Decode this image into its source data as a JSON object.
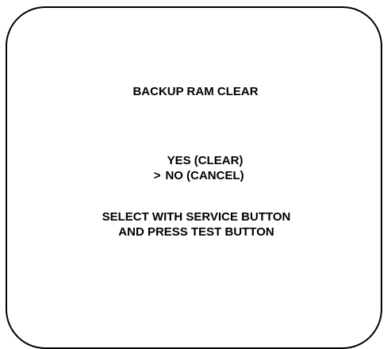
{
  "screen": {
    "title": "BACKUP RAM CLEAR",
    "options": [
      {
        "label": "YES (CLEAR)",
        "selected": false
      },
      {
        "label": "NO (CANCEL)",
        "selected": true
      }
    ],
    "cursor_symbol": ">",
    "instructions": [
      "SELECT WITH SERVICE BUTTON",
      "AND PRESS TEST BUTTON"
    ]
  },
  "colors": {
    "background": "#ffffff",
    "text": "#000000",
    "frame": "#000000"
  }
}
